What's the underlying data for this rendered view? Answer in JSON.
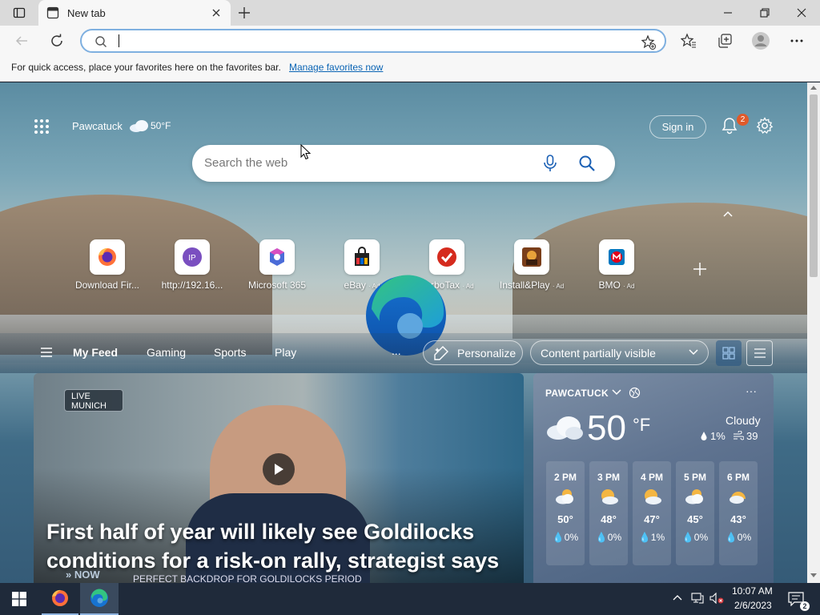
{
  "colors": {
    "accent_blue": "#0a64b4",
    "badge_orange": "#e05a2a",
    "taskbar": "#1f2a3a"
  },
  "browser": {
    "tab_title": "New tab",
    "address_value": "",
    "favbar_text": "For quick access, place your favorites here on the favorites bar.",
    "favbar_link": "Manage favorites now"
  },
  "ntp": {
    "location": "Pawcatuck",
    "temp": "50°F",
    "sign_in": "Sign in",
    "notifications_count": "2",
    "search_placeholder": "Search the web"
  },
  "quick_links": [
    {
      "label": "Download Fir...",
      "ad": "",
      "icon": "firefox-icon"
    },
    {
      "label": "http://192.16...",
      "ad": "",
      "icon": "ip-icon"
    },
    {
      "label": "Microsoft 365",
      "ad": "",
      "icon": "microsoft-365-icon"
    },
    {
      "label": "eBay",
      "ad": "· Ad",
      "icon": "ebay-icon"
    },
    {
      "label": "TurboTax",
      "ad": "· Ad",
      "icon": "turbotax-icon"
    },
    {
      "label": "Install&Play",
      "ad": "· Ad",
      "icon": "install-play-icon"
    },
    {
      "label": "BMO",
      "ad": "· Ad",
      "icon": "bmo-icon"
    }
  ],
  "feed_nav": {
    "items": [
      "My Feed",
      "Gaming",
      "Sports",
      "Play"
    ],
    "more": "...",
    "personalize": "Personalize",
    "content_visibility": "Content partially visible"
  },
  "hero": {
    "live_line1": "LIVE",
    "live_line2": "MUNICH",
    "title": "First half of year will likely see Goldilocks conditions for a risk-on rally, strategist says",
    "tv_ticker": "PERFECT BACKDROP FOR GOLDILOCKS PERIOD",
    "tv_now": "» NOW"
  },
  "weather": {
    "location": "PAWCATUCK",
    "temp": "50",
    "unit": "°F",
    "condition": "Cloudy",
    "precip": "1%",
    "wind": "39",
    "more": "···",
    "hours": [
      {
        "time": "2 PM",
        "temp": "50°",
        "precip": "0%",
        "icon": "partly-cloudy-icon"
      },
      {
        "time": "3 PM",
        "temp": "48°",
        "precip": "0%",
        "icon": "sun-cloud-icon"
      },
      {
        "time": "4 PM",
        "temp": "47°",
        "precip": "1%",
        "icon": "sun-cloud-icon"
      },
      {
        "time": "5 PM",
        "temp": "45°",
        "precip": "0%",
        "icon": "partly-cloudy-icon"
      },
      {
        "time": "6 PM",
        "temp": "43°",
        "precip": "0%",
        "icon": "sunset-cloud-icon"
      }
    ]
  },
  "taskbar": {
    "time": "10:07 AM",
    "date": "2/6/2023",
    "notification_count": "2"
  }
}
